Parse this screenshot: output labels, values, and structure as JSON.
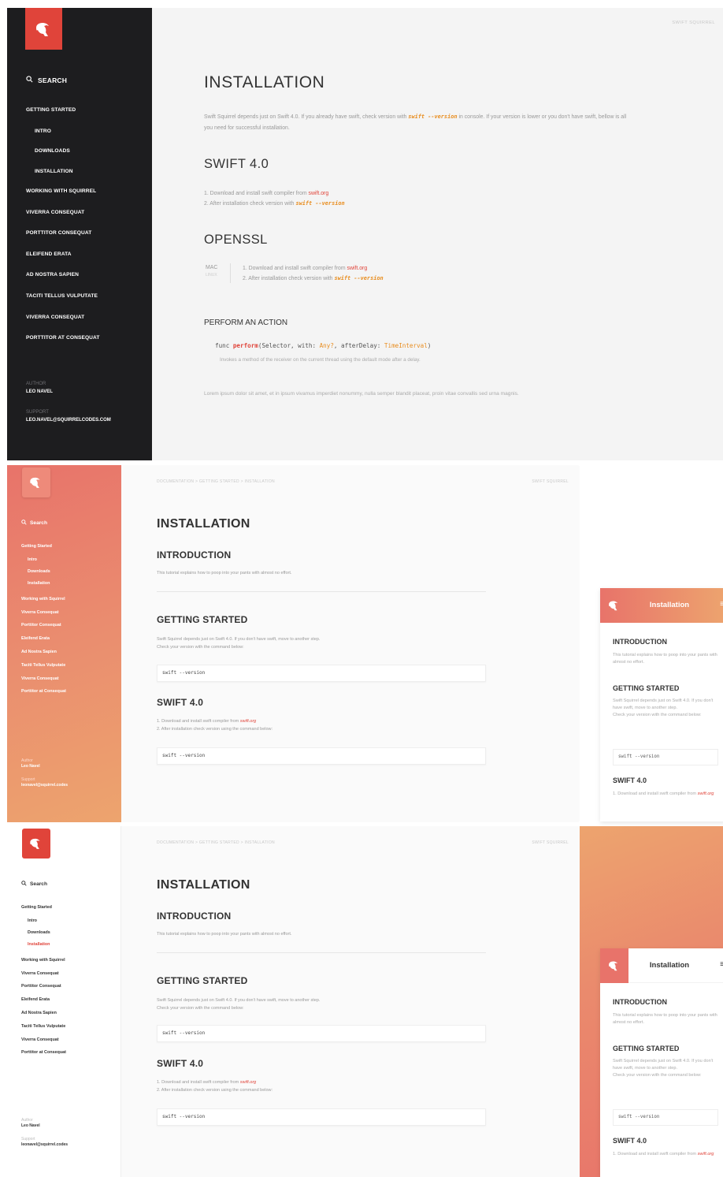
{
  "brand_colors": {
    "red": "#e0443a",
    "orange": "#e88d1f",
    "dark": "#1d1d1f"
  },
  "p1": {
    "search": "SEARCH",
    "nav": [
      {
        "label": "GETTING STARTED",
        "sub": false
      },
      {
        "label": "INTRO",
        "sub": true
      },
      {
        "label": "DOWNLOADS",
        "sub": true
      },
      {
        "label": "INSTALLATION",
        "sub": true
      },
      {
        "label": "WORKING WITH SQUIRREL",
        "sub": false
      },
      {
        "label": "VIVERRA CONSEQUAT",
        "sub": false
      },
      {
        "label": "PORTTITOR CONSEQUAT",
        "sub": false
      },
      {
        "label": "ELEIFEND ERATA",
        "sub": false
      },
      {
        "label": "AD NOSTRA SAPIEN",
        "sub": false
      },
      {
        "label": "TACITI TELLUS VULPUTATE",
        "sub": false
      },
      {
        "label": "VIVERRA CONSEQUAT",
        "sub": false
      },
      {
        "label": "PORTTITOR AT CONSEQUAT",
        "sub": false
      }
    ],
    "author_label": "AUTHOR",
    "author": "LEO NAVEL",
    "support_label": "SUPPORT",
    "support": "LEO.NAVEL@SQUIRRELCODES.COM",
    "brand": "SWIFT SQUIRREL",
    "title": "INSTALLATION",
    "intro_a": "Swift Squirrel depends just on Swift 4.0. If you already have swift, check version with ",
    "intro_code": "swift --version",
    "intro_b": " in console. If your version is lower or you don't have swift, bellow is all you need for successful installation.",
    "h_swift": "SWIFT 4.0",
    "step1_a": "1.  Download and install swift compiler from ",
    "step1_link": "swift.org",
    "step2_a": "2.  After installation check version with ",
    "step2_code": "swift --version",
    "h_openssl": "OPENSSL",
    "os": "MAC",
    "os_sub": "LINUX",
    "h_action": "PERFORM AN ACTION",
    "func_kw": "func ",
    "func_name": "perform",
    "func_a": "(Selector, with: ",
    "func_t1": "Any?",
    "func_b": ", afterDelay: ",
    "func_t2": "TimeInterval",
    "func_c": ")",
    "func_desc": "Invokes a method of the receiver on the current thread using the default mode after a delay.",
    "lorem": "Lorem ipsum dolor sit amet, et in ipsum vivamus imperdiet nonummy, nulla semper blandit placeat, proin vitae convallis sed urna magnis."
  },
  "p2": {
    "search": "Search",
    "nav": [
      {
        "label": "Getting Started",
        "sub": false
      },
      {
        "label": "Intro",
        "sub": true
      },
      {
        "label": "Downloads",
        "sub": true
      },
      {
        "label": "Installation",
        "sub": true
      },
      {
        "label": "Working with Squirrel",
        "sub": false,
        "gap": true
      },
      {
        "label": "Viverra Consequat",
        "sub": false
      },
      {
        "label": "Porttitor Consequat",
        "sub": false
      },
      {
        "label": "Eleifend Erata",
        "sub": false
      },
      {
        "label": "Ad Nostra Sapien",
        "sub": false
      },
      {
        "label": "Taciti Tellus Vulputate",
        "sub": false
      },
      {
        "label": "Viverra Consequat",
        "sub": false
      },
      {
        "label": "Porttitor at Consequat",
        "sub": false
      }
    ],
    "author_label": "Author",
    "author": "Leo Navel",
    "support_label": "Support",
    "support": "leonavel@squirrel.codes",
    "crumb": "DOCUMENTATION  >  GETTING STARTED  >  INSTALLATION",
    "brand": "SWIFT SQUIRREL",
    "title": "INSTALLATION",
    "h_intro": "INTRODUCTION",
    "intro": "This tutorial explains how to poop into your pants with almost no effort.",
    "h_gs": "GETTING STARTED",
    "gs_1": "Swift Squirrel depends just on Swift 4.0. If you don't have swift, move to another step.",
    "gs_2": "Check your version with the command below:",
    "cmd": "swift --version",
    "h_swift": "SWIFT 4.0",
    "s1_a": "1.  Download and install swift compiler from ",
    "s1_link": "swift.org",
    "s2": "2.  After installation check version using the command below:",
    "cmd2": "swift --version"
  },
  "p3": {
    "search": "Search",
    "nav": [
      {
        "label": "Getting Started",
        "sub": false
      },
      {
        "label": "Intro",
        "sub": true
      },
      {
        "label": "Downloads",
        "sub": true
      },
      {
        "label": "Installation",
        "sub": true,
        "active": true
      },
      {
        "label": "Working with Squirrel",
        "sub": false,
        "gap": true
      },
      {
        "label": "Viverra Consequat",
        "sub": false
      },
      {
        "label": "Porttitor Consequat",
        "sub": false
      },
      {
        "label": "Eleifend Erata",
        "sub": false
      },
      {
        "label": "Ad Nostra Sapien",
        "sub": false
      },
      {
        "label": "Taciti Tellus Vulputate",
        "sub": false
      },
      {
        "label": "Viverra Consequat",
        "sub": false
      },
      {
        "label": "Porttitor at Consequat",
        "sub": false
      }
    ],
    "author_label": "Author",
    "author": "Leo Navel",
    "support_label": "Support",
    "support": "leonavel@squirrel.codes",
    "crumb": "DOCUMENTATION  >  GETTING STARTED  >  INSTALLATION",
    "brand": "SWIFT SQUIRREL",
    "title": "INSTALLATION",
    "h_intro": "INTRODUCTION",
    "intro": "This tutorial explains how to poop into your pants with almost no effort.",
    "h_gs": "GETTING STARTED",
    "gs_1": "Swift Squirrel depends just on Swift 4.0. If you don't have swift, move to another step.",
    "gs_2": "Check your version with the command below:",
    "cmd": "swift --version",
    "h_swift": "SWIFT 4.0",
    "s1_a": "1.  Download and install swift compiler from ",
    "s1_link": "swift.org",
    "s2": "2.  After installation check version using the command below:",
    "cmd2": "swift --version"
  },
  "m1": {
    "title": "Installation",
    "menu": "≡",
    "h_intro": "INTRODUCTION",
    "intro": "This tutorial explains how to poop into your pants with almost no effort.",
    "h_gs": "GETTING STARTED",
    "gs_1": "Swift Squirrel depends just on Swift 4.0. If you don't have swift, move to another step.",
    "gs_2": "Check your version with the command below:",
    "cmd": "swift --version",
    "h_swift": "SWIFT 4.0",
    "s1_a": "1. Download and install swift compiler from ",
    "s1_link": "swift.org"
  },
  "m2": {
    "title": "Installation",
    "menu": "≡",
    "h_intro": "INTRODUCTION",
    "intro": "This tutorial explains how to poop into your pants with almost no effort.",
    "h_gs": "GETTING STARTED",
    "gs_1": "Swift Squirrel depends just on Swift 4.0. If you don't have swift, move to another step.",
    "gs_2": "Check your version with the command below:",
    "cmd": "swift --version",
    "h_swift": "SWIFT 4.0",
    "s1_a": "1. Download and install swift compiler from ",
    "s1_link": "swift.org"
  }
}
